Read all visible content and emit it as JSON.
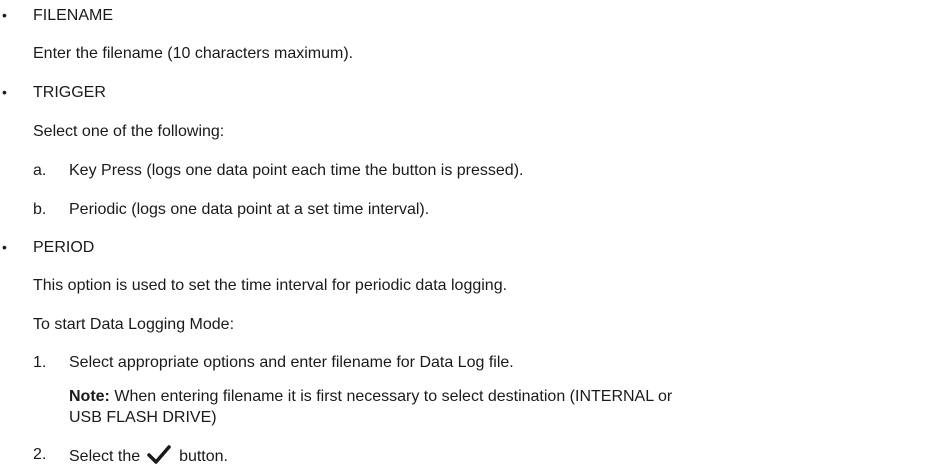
{
  "sections": [
    {
      "bullet": "•",
      "heading": "FILENAME",
      "text": "Enter the filename (10 characters maximum)."
    },
    {
      "bullet": "•",
      "heading": "TRIGGER",
      "text": "Select one of the following:",
      "items": [
        {
          "marker": "a.",
          "text": "Key Press (logs one data point each time the button is pressed)."
        },
        {
          "marker": "b.",
          "text": "Periodic (logs one data point at a set time interval)."
        }
      ]
    },
    {
      "bullet": "•",
      "heading": "PERIOD",
      "text": "This option is used to set the time interval for periodic data logging."
    }
  ],
  "start_intro": "To start Data Logging Mode:",
  "steps": [
    {
      "marker": "1.",
      "text": "Select appropriate options and enter filename for Data Log file.",
      "note_label": "Note:",
      "note_line1": "When entering filename it is first necessary to select destination (INTERNAL or",
      "note_line2": "USB FLASH DRIVE)"
    },
    {
      "marker": "2.",
      "text_before": "Select the",
      "icon": "checkmark-icon",
      "text_after": "button."
    }
  ]
}
